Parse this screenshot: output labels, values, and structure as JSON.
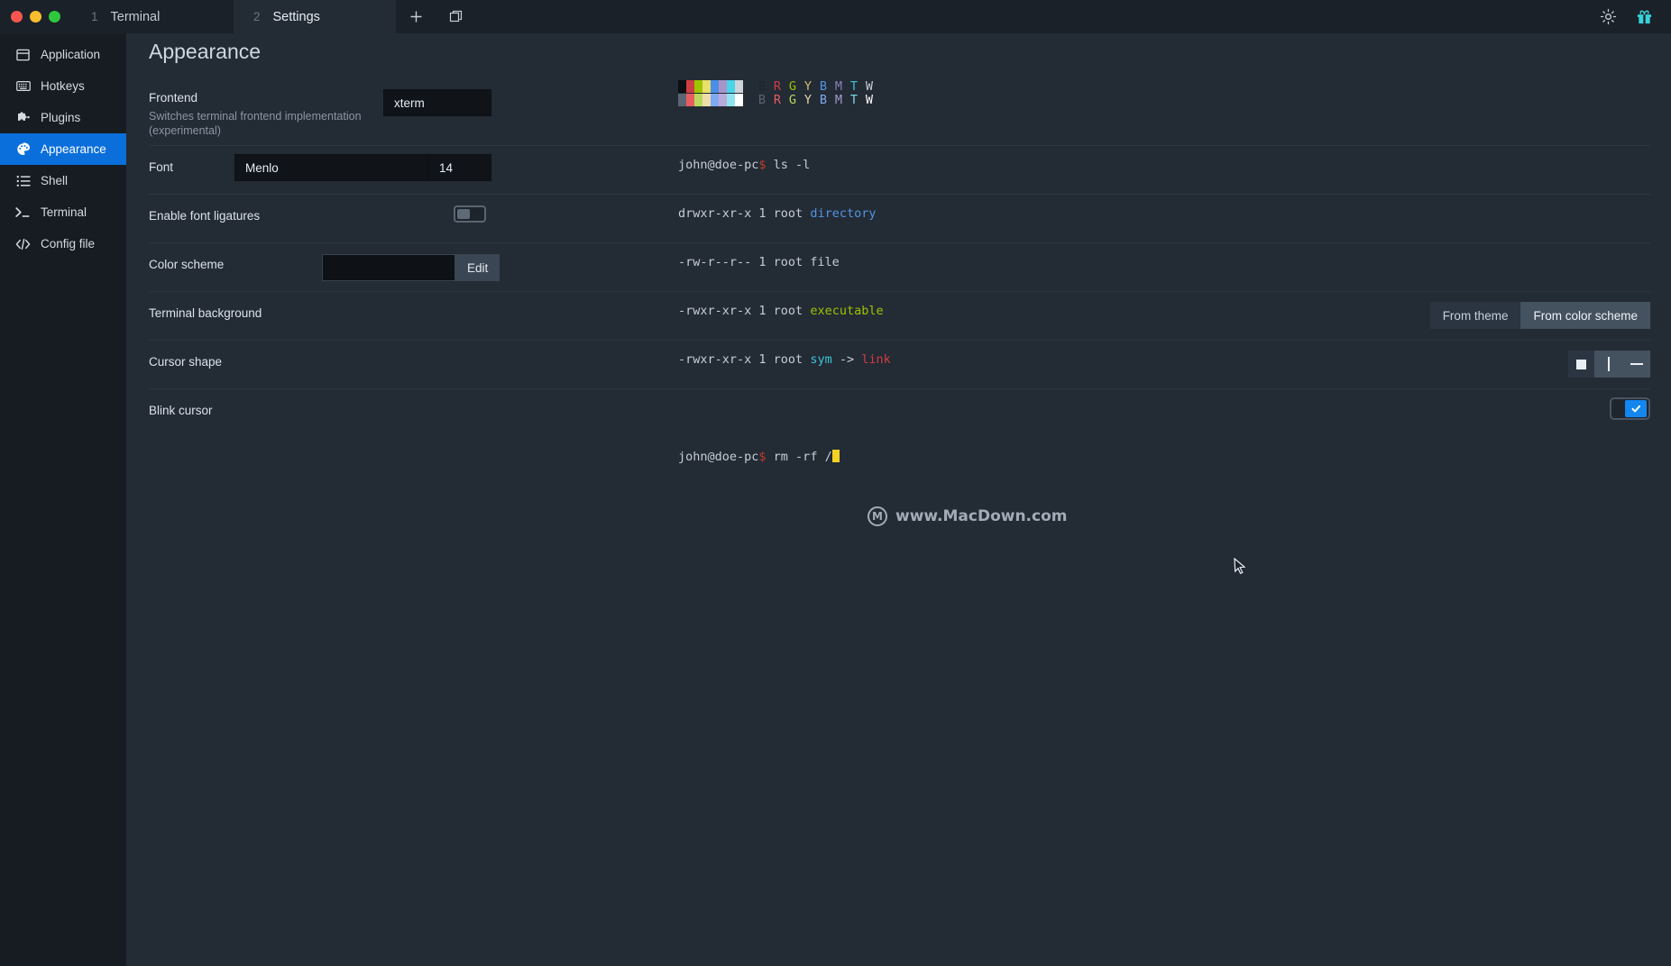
{
  "window": {
    "traffic_lights": [
      "close",
      "minimize",
      "maximize"
    ],
    "tabs": [
      {
        "number": "1",
        "label": "Terminal",
        "active": false
      },
      {
        "number": "2",
        "label": "Settings",
        "active": true
      }
    ],
    "new_tab_icon": "plus-icon",
    "split_icon": "split-pane-icon",
    "settings_icon": "gear-icon",
    "gift_icon": "gift-icon"
  },
  "sidebar": {
    "items": [
      {
        "label": "Application",
        "icon": "window-icon",
        "active": false
      },
      {
        "label": "Hotkeys",
        "icon": "keyboard-icon",
        "active": false
      },
      {
        "label": "Plugins",
        "icon": "puzzle-icon",
        "active": false
      },
      {
        "label": "Appearance",
        "icon": "palette-icon",
        "active": true
      },
      {
        "label": "Shell",
        "icon": "list-icon",
        "active": false
      },
      {
        "label": "Terminal",
        "icon": "terminal-icon",
        "active": false
      },
      {
        "label": "Config file",
        "icon": "code-icon",
        "active": false
      }
    ]
  },
  "page": {
    "title": "Appearance",
    "settings": [
      {
        "label": "Frontend",
        "description": "Switches terminal frontend implementation (experimental)",
        "control": "text",
        "value": "xterm"
      },
      {
        "label": "Font",
        "description": "",
        "control": "font",
        "value": "Menlo",
        "size": "14"
      },
      {
        "label": "Enable font ligatures",
        "description": "",
        "control": "toggle",
        "value": "off"
      },
      {
        "label": "Color scheme",
        "description": "",
        "control": "swatch",
        "value": "",
        "button_label": "Edit"
      },
      {
        "label": "Terminal background",
        "description": "",
        "control": "segmented",
        "options": [
          "From theme",
          "From color scheme"
        ],
        "selected": "From color scheme"
      },
      {
        "label": "Cursor shape",
        "description": "",
        "control": "shape",
        "options": [
          "block",
          "beam",
          "underline"
        ],
        "selected": "beam"
      },
      {
        "label": "Blink cursor",
        "description": "",
        "control": "checkbox",
        "checked": true
      }
    ]
  },
  "preview": {
    "palette_label_letters": [
      "B",
      "R",
      "G",
      "Y",
      "B",
      "M",
      "T",
      "W"
    ],
    "palette_normal": [
      "#0b0f14",
      "#cc3e44",
      "#9ec400",
      "#e8e06a",
      "#4a8ee8",
      "#a795c9",
      "#4bd3e8",
      "#cfd3da"
    ],
    "palette_bright": [
      "#5b6472",
      "#e85c60",
      "#b8d95e",
      "#f0ddaa",
      "#7fa9f2",
      "#b9abda",
      "#8fe4f0",
      "#ffffff"
    ],
    "letter_colors_normal": [
      "#1d252e",
      "#cc3e44",
      "#9ec400",
      "#d4bb6d",
      "#5294e2",
      "#8b7fb8",
      "#3cc5d6",
      "#c9ccd3"
    ],
    "letter_colors_bright": [
      "#5b6472",
      "#e85c60",
      "#b8d95e",
      "#e4d9a0",
      "#7fa9f2",
      "#a79ace",
      "#7fd9e8",
      "#ffffff"
    ],
    "lines": [
      {
        "prompt": "john@doe-pc",
        "sym": "$",
        "text": " ls -l"
      },
      {
        "text": "drwxr-xr-x 1 root ",
        "colored": "directory",
        "color_name": "blue"
      },
      {
        "text": "-rw-r--r-- 1 root file"
      },
      {
        "text": "-rwxr-xr-x 1 root ",
        "colored": "executable",
        "color_name": "green"
      },
      {
        "text": "-rwxr-xr-x 1 root ",
        "colored": "sym",
        "color_name": "cyan",
        "arrow": " -> ",
        "colored2": "link",
        "color_name2": "red"
      },
      {
        "text": ""
      },
      {
        "prompt": "john@doe-pc",
        "sym": "$",
        "text": " rm -rf /",
        "cursor": true
      }
    ]
  },
  "watermark": {
    "logo": "macdown-logo-icon",
    "logo_letter": "M",
    "text": "www.MacDown.com"
  },
  "colors": {
    "accent": "#0a6fdb",
    "window_bg": "#1b2129",
    "sidebar_bg": "#171c23",
    "main_bg": "#232b35",
    "field_bg": "#101419",
    "checkbox_on": "#1386f0",
    "cursor_yellow": "#f2d024"
  }
}
